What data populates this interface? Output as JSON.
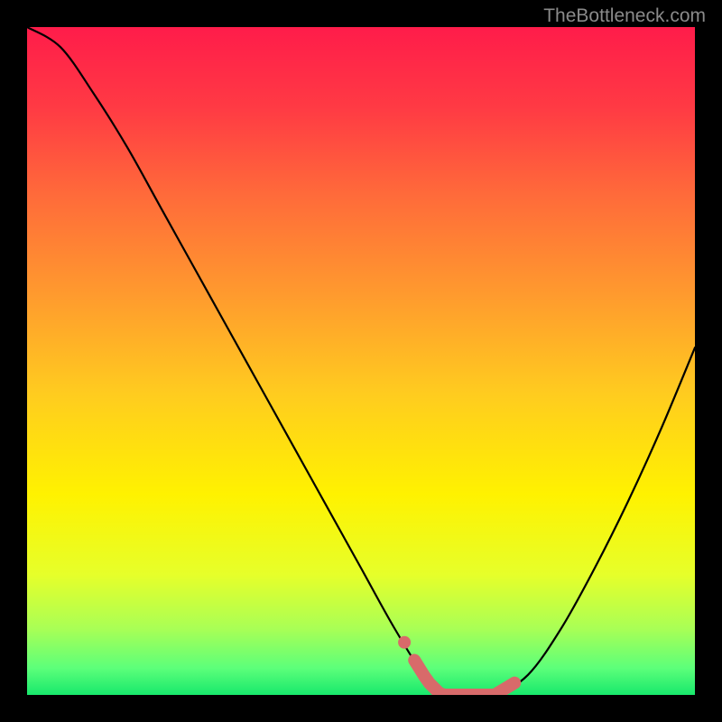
{
  "watermark": "TheBottleneck.com",
  "chart_data": {
    "type": "line",
    "title": "",
    "xlabel": "",
    "ylabel": "",
    "xlim": [
      0,
      100
    ],
    "ylim": [
      0,
      100
    ],
    "series": [
      {
        "name": "bottleneck-curve",
        "x": [
          0,
          5,
          10,
          15,
          20,
          25,
          30,
          35,
          40,
          45,
          50,
          55,
          60,
          62,
          65,
          70,
          75,
          80,
          85,
          90,
          95,
          100
        ],
        "values": [
          100,
          97,
          90,
          82,
          73,
          64,
          55,
          46,
          37,
          28,
          19,
          10,
          2,
          0,
          0,
          0,
          3,
          10,
          19,
          29,
          40,
          52
        ]
      }
    ],
    "annotations": [
      {
        "name": "highlight-band",
        "x_range": [
          58,
          73
        ],
        "y": 0,
        "color": "#d86a6a"
      }
    ],
    "background_gradient": {
      "type": "vertical",
      "stops": [
        {
          "pos": 0.0,
          "color": "#ff1c4a"
        },
        {
          "pos": 0.12,
          "color": "#ff3a44"
        },
        {
          "pos": 0.25,
          "color": "#ff6a3a"
        },
        {
          "pos": 0.4,
          "color": "#ff9a2e"
        },
        {
          "pos": 0.55,
          "color": "#ffcc1f"
        },
        {
          "pos": 0.7,
          "color": "#fff200"
        },
        {
          "pos": 0.82,
          "color": "#e6ff2a"
        },
        {
          "pos": 0.9,
          "color": "#aaff55"
        },
        {
          "pos": 0.96,
          "color": "#5cff7a"
        },
        {
          "pos": 1.0,
          "color": "#18e86c"
        }
      ]
    }
  }
}
